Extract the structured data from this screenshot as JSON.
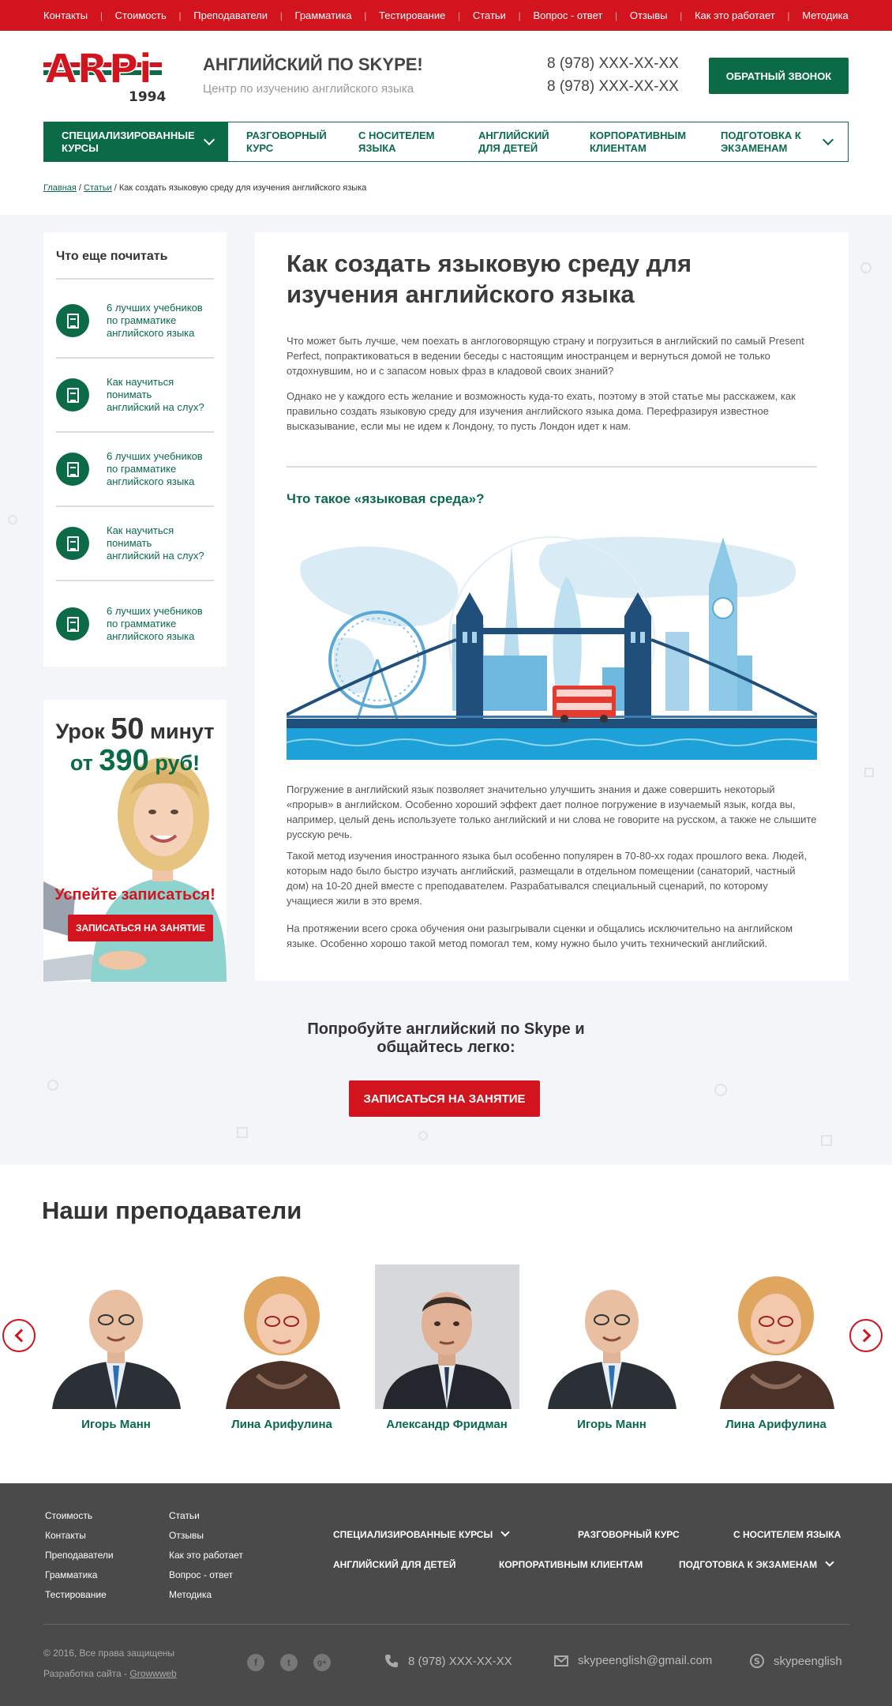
{
  "topnav": [
    "Контакты",
    "Стоимость",
    "Преподаватели",
    "Грамматика",
    "Тестирование",
    "Статьи",
    "Вопрос - ответ",
    "Отзывы",
    "Как это работает",
    "Методика"
  ],
  "header": {
    "logo_text": "ARPi",
    "logo_year": "1994",
    "site_name": "АНГЛИЙСКИЙ ПО SKYPE!",
    "site_sub": "Центр по изучению английского языка",
    "phone1": "8 (978) XXX-XX-XX",
    "phone2": "8 (978) XXX-XX-XX",
    "callback": "ОБРАТНЫЙ ЗВОНОК"
  },
  "mainnav": [
    {
      "l1": "СПЕЦИАЛИЗИРОВАННЫЕ",
      "l2": "КУРСЫ"
    },
    {
      "l1": "РАЗГОВОРНЫЙ",
      "l2": "КУРС"
    },
    {
      "l1": "С НОСИТЕЛЕМ",
      "l2": "ЯЗЫКА"
    },
    {
      "l1": "АНГЛИЙСКИЙ",
      "l2": "ДЛЯ ДЕТЕЙ"
    },
    {
      "l1": "КОРПОРАТИВНЫМ",
      "l2": "КЛИЕНТАМ"
    },
    {
      "l1": "ПОДГОТОВКА К",
      "l2": "ЭКЗАМЕНАМ"
    }
  ],
  "breadcrumb": {
    "home": "Главная",
    "sep": " / ",
    "articles": "Статьи",
    "current": "Как создать языковую среду для изучения английского языка"
  },
  "sidebar": {
    "title": "Что еще почитать",
    "items": [
      {
        "l1": "6 лучших учебников",
        "l2": "по грамматике",
        "l3": "английского языка"
      },
      {
        "l1": "Как научиться",
        "l2": "понимать",
        "l3": "английский на слух?"
      },
      {
        "l1": "6 лучших учебников",
        "l2": "по грамматике",
        "l3": "английского языка"
      },
      {
        "l1": "Как научиться",
        "l2": "понимать",
        "l3": "английский на слух?"
      },
      {
        "l1": "6 лучших учебников",
        "l2": "по грамматике",
        "l3": "английского языка"
      }
    ]
  },
  "promo": {
    "l1a": "Урок ",
    "l1b": "50",
    "l1c": " минут",
    "l2a": "от ",
    "l2b": "390",
    "l2c": " руб!",
    "hurry": "Успейте записаться!",
    "button": "ЗАПИСАТЬСЯ НА ЗАНЯТИЕ"
  },
  "article": {
    "title": "Как создать языковую среду для изучения английского языка",
    "p1": "Что может быть лучше, чем поехать в англоговорящую страну и погрузиться в английский по самый Present Perfect, попрактиковаться в ведении беседы с настоящим иностранцем и вернуться домой не только отдохнувшим, но и с запасом новых фраз в кладовой своих знаний?",
    "p2": "Однако не у каждого есть желание и возможность куда-то ехать, поэтому в этой статье мы расскажем, как правильно создать языковую среду для изучения английского языка дома. Перефразируя известное высказывание, если мы не идем к Лондону, то пусть Лондон идет к нам.",
    "h2": "Что такое «языковая среда»?",
    "p3": "Погружение в английский язык позволяет значительно улучшить знания и даже совершить некоторый «прорыв» в английском. Особенно хороший эффект дает полное погружение в изучаемый язык, когда вы, например, целый день используете только английский и ни слова не говорите на русском, а также не слышите русскую речь.",
    "p4": "Такой метод изучения иностранного языка был особенно популярен в 70-80-хх годах прошлого века. Людей, которым надо было быстро изучать английский, размещали в отдельном помещении (санаторий, частный дом) на 10-20 дней вместе с преподавателем. Разрабатывался специальный сценарий, по которому учащиеся жили в это время.",
    "p5": "На протяжении всего срока обучения они разыгрывали сценки и общались исключительно на английском языке. Особенно хорошо такой метод помогал тем, кому нужно было учить технический английский."
  },
  "cta": {
    "l1": "Попробуйте английский по Skype и",
    "l2": "общайтесь легко:",
    "button": "ЗАПИСАТЬСЯ НА ЗАНЯТИЕ"
  },
  "teachers": {
    "title": "Наши преподаватели",
    "items": [
      {
        "name": "Игорь Манн",
        "look": "man-bald"
      },
      {
        "name": "Лина Арифулина",
        "look": "woman"
      },
      {
        "name": "Александр Фридман",
        "look": "man-dark"
      },
      {
        "name": "Игорь Манн",
        "look": "man-bald"
      },
      {
        "name": "Лина Арифулина",
        "look": "woman"
      }
    ]
  },
  "footer": {
    "col1": [
      "Стоимость",
      "Контакты",
      "Преподаватели",
      "Грамматика",
      "Тестирование"
    ],
    "col2": [
      "Статьи",
      "Отзывы",
      "Как это работает",
      "Вопрос - ответ",
      "Методика"
    ],
    "nav": [
      "СПЕЦИАЛИЗИРОВАННЫЕ КУРСЫ",
      "РАЗГОВОРНЫЙ КУРС",
      "С НОСИТЕЛЕМ ЯЗЫКА",
      "АНГЛИЙСКИЙ ДЛЯ ДЕТЕЙ",
      "КОРПОРАТИВНЫМ КЛИЕНТАМ",
      "ПОДГОТОВКА К ЭКЗАМЕНАМ"
    ],
    "copyright": "© 2016, Все права защищены",
    "dev_prefix": "Разработка сайта - ",
    "dev_link": "Growwweb",
    "social": [
      "f",
      "t",
      "g+"
    ],
    "phone": "8 (978) XXX-XX-XX",
    "email": "skypeenglish@gmail.com",
    "skype": "skypeenglish"
  },
  "colors": {
    "brand_red": "#d2141e",
    "brand_green": "#0a6b46",
    "footer_bg": "#4a4a4a",
    "content_bg": "#f4f5f8"
  },
  "icons": [
    "document-icon",
    "chevron-down-icon",
    "arrow-left-icon",
    "arrow-right-icon",
    "phone-icon",
    "mail-icon",
    "skype-icon",
    "facebook-icon",
    "twitter-icon",
    "google-plus-icon"
  ]
}
